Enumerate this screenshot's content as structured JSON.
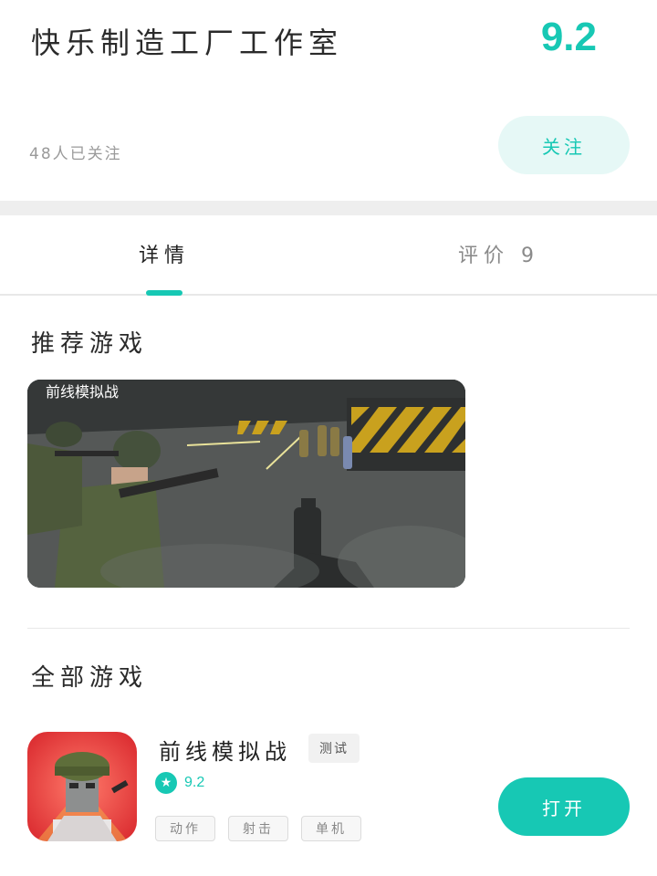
{
  "header": {
    "studio_name": "快乐制造工厂工作室",
    "score": "9.2",
    "followers": "48人已关注",
    "follow_label": "关注"
  },
  "tabs": [
    {
      "label": "详情"
    },
    {
      "label": "评价 9"
    }
  ],
  "recommended": {
    "title": "推荐游戏",
    "card_label": "前线模拟战"
  },
  "all_games": {
    "title": "全部游戏",
    "items": [
      {
        "name": "前线模拟战",
        "badge": "测试",
        "rating": "9.2",
        "tags": [
          "动作",
          "射击",
          "单机"
        ],
        "action_label": "打开"
      }
    ]
  },
  "colors": {
    "accent": "#17c8b4",
    "follow_bg": "#e6f8f6",
    "band": "#eeeeee"
  },
  "icons": {
    "rating": "star-icon"
  }
}
